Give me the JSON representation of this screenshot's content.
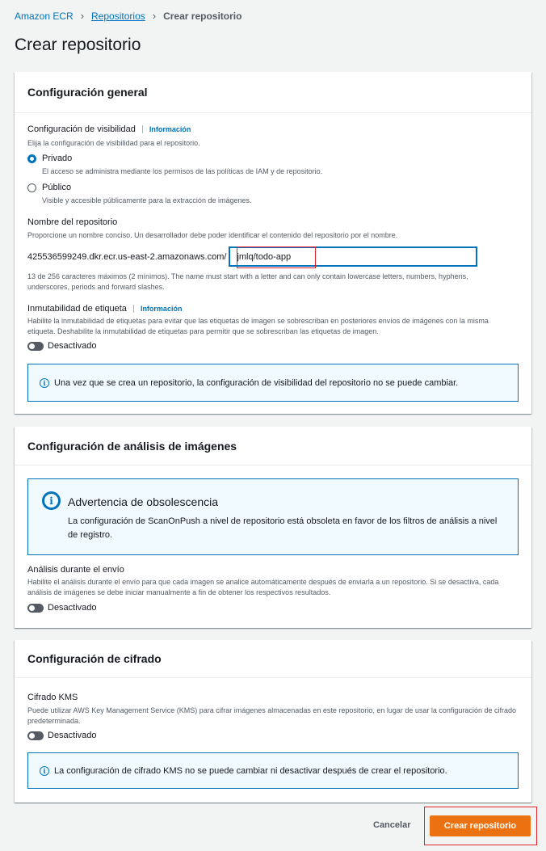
{
  "breadcrumb": {
    "items": [
      "Amazon ECR",
      "Repositorios"
    ],
    "current": "Crear repositorio"
  },
  "page_title": "Crear repositorio",
  "general": {
    "title": "Configuración general",
    "visibility_label": "Configuración de visibilidad",
    "info_label": "Información",
    "visibility_desc": "Elija la configuración de visibilidad para el repositorio.",
    "private_label": "Privado",
    "private_desc": "El acceso se administra mediante los permisos de las políticas de IAM y de repositorio.",
    "public_label": "Público",
    "public_desc": "Visible y accesible públicamente para la extracción de imágenes.",
    "name_label": "Nombre del repositorio",
    "name_desc": "Proporcione un nombre conciso. Un desarrollador debe poder identificar el contenido del repositorio por el nombre.",
    "uri_prefix": "425536599249.dkr.ecr.us-east-2.amazonaws.com/",
    "repo_name_value": "jmlq/todo-app",
    "name_constraint": "13 de 256 caracteres máximos (2 mínimos). The name must start with a letter and can only contain lowercase letters, numbers, hyphens, underscores, periods and forward slashes.",
    "immutability_label": "Inmutabilidad de etiqueta",
    "immutability_desc": "Habilite la inmutabilidad de etiquetas para evitar que las etiquetas de imagen se sobrescriban en posteriores envíos de imágenes con la misma etiqueta. Deshabilite la inmutabilidad de etiquetas para permitir que se sobrescriban las etiquetas de imagen.",
    "toggle_off": "Desactivado",
    "visibility_notice": "Una vez que se crea un repositorio, la configuración de visibilidad del repositorio no se puede cambiar."
  },
  "scan": {
    "title": "Configuración de análisis de imágenes",
    "warning_title": "Advertencia de obsolescencia",
    "warning_text": "La configuración de ScanOnPush a nivel de repositorio está obsoleta en favor de los filtros de análisis a nivel de registro.",
    "push_label": "Análisis durante el envío",
    "push_desc": "Habilite el análisis durante el envío para que cada imagen se analice automáticamente después de enviarla a un repositorio. Si se desactiva, cada análisis de imágenes se debe iniciar manualmente a fin de obtener los respectivos resultados.",
    "toggle_off": "Desactivado"
  },
  "encryption": {
    "title": "Configuración de cifrado",
    "kms_label": "Cifrado KMS",
    "kms_desc": "Puede utilizar AWS Key Management Service (KMS) para cifrar imágenes almacenadas en este repositorio, en lugar de usar la configuración de cifrado predeterminada.",
    "toggle_off": "Desactivado",
    "notice": "La configuración de cifrado KMS no se puede cambiar ni desactivar después de crear el repositorio."
  },
  "actions": {
    "cancel": "Cancelar",
    "create": "Crear repositorio"
  },
  "colors": {
    "primary": "#ec7211",
    "link": "#0073bb",
    "highlight": "#e3242b"
  }
}
